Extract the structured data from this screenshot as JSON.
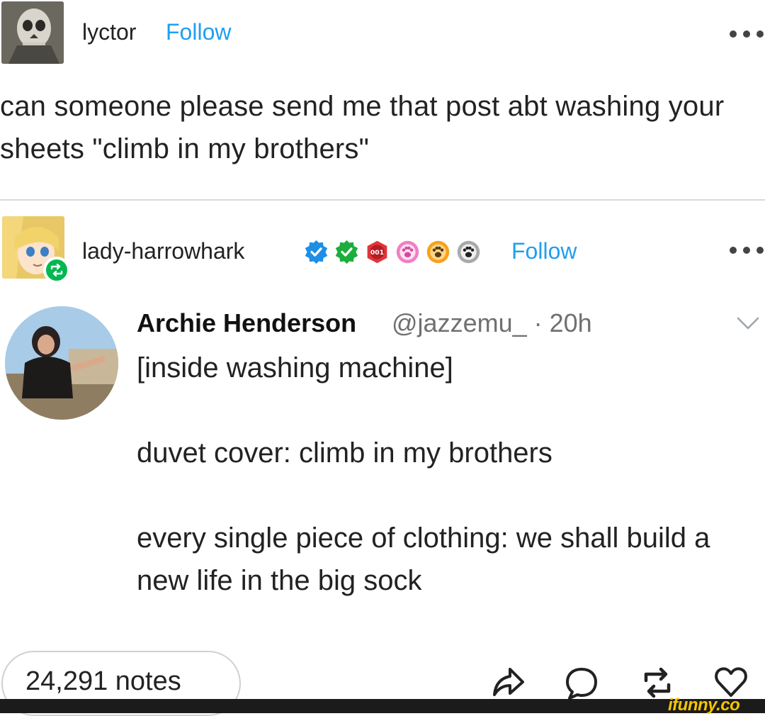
{
  "post": {
    "username": "lyctor",
    "follow_label": "Follow",
    "text": "can someone please send me that post abt washing your sheets \"climb in my brothers\""
  },
  "reblog": {
    "username": "lady-harrowhark",
    "follow_label": "Follow",
    "badge_icons": [
      "verified-blue-badge",
      "verified-green-badge",
      "red-001-badge",
      "pink-paw-badge",
      "orange-paw-badge",
      "gray-paw-badge"
    ],
    "badge_001_text": "001"
  },
  "tweet": {
    "name": "Archie Henderson",
    "handle_time": "@jazzemu_ · 20h",
    "line1": "[inside washing machine]",
    "line2": "duvet cover: climb in my brothers",
    "line3": "every single piece of clothing: we shall build a new life in the big sock"
  },
  "footer": {
    "notes": "24,291 notes",
    "action_icons": [
      "share-icon",
      "comment-icon",
      "reblog-icon",
      "heart-icon"
    ]
  },
  "watermark": "ifunny.co",
  "colors": {
    "follow": "#1f9ff0",
    "reblog_green": "#00b84f",
    "text": "#222222",
    "secondary": "#707070",
    "watermark": "#f5c400"
  }
}
